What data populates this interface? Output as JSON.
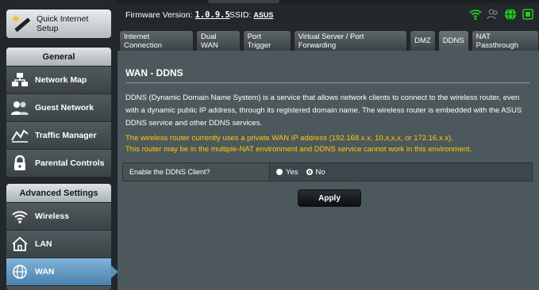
{
  "left_menu": {
    "quick_setup_label": "Quick Internet Setup",
    "general": {
      "heading": "General",
      "items": [
        {
          "label": "Network Map",
          "icon": "network-map-icon"
        },
        {
          "label": "Guest Network",
          "icon": "guest-network-icon"
        },
        {
          "label": "Traffic Manager",
          "icon": "traffic-manager-icon"
        },
        {
          "label": "Parental Controls",
          "icon": "parental-controls-icon"
        }
      ]
    },
    "advanced": {
      "heading": "Advanced Settings",
      "items": [
        {
          "label": "Wireless",
          "icon": "wireless-icon"
        },
        {
          "label": "LAN",
          "icon": "lan-icon"
        },
        {
          "label": "WAN",
          "icon": "wan-icon",
          "active": true
        }
      ]
    }
  },
  "header": {
    "firmware_label": "Firmware Version:",
    "firmware_value": "1.0.9.5",
    "ssid_label": "SSID:",
    "ssid_value": "ASUS"
  },
  "tabs": [
    {
      "label": "Internet Connection"
    },
    {
      "label": "Dual WAN"
    },
    {
      "label": "Port Trigger"
    },
    {
      "label": "Virtual Server / Port Forwarding"
    },
    {
      "label": "DMZ"
    },
    {
      "label": "DDNS",
      "active": true
    },
    {
      "label": "NAT Passthrough"
    }
  ],
  "main": {
    "title": "WAN - DDNS",
    "description": "DDNS (Dynamic Domain Name System) is a service that allows network clients to connect to the wireless router, even with a dynamic public IP address, through its registered domain name. The wireless router is embedded with the ASUS DDNS service and other DDNS services.",
    "warning_line1": "The wireless router currently uses a private WAN IP address (192.168.x.x, 10,x,x,x, or 172.16.x.x).",
    "warning_line2": "This router may be in the multiple-NAT environment and DDNS service cannot work in this environment.",
    "enable_label": "Enable the DDNS Client?",
    "option_yes": "Yes",
    "option_no": "No",
    "selected": "No",
    "apply_label": "Apply"
  },
  "colors": {
    "accent_active": "#5a8fb8",
    "warning": "#ffcc00",
    "status_green": "#22cc22"
  }
}
